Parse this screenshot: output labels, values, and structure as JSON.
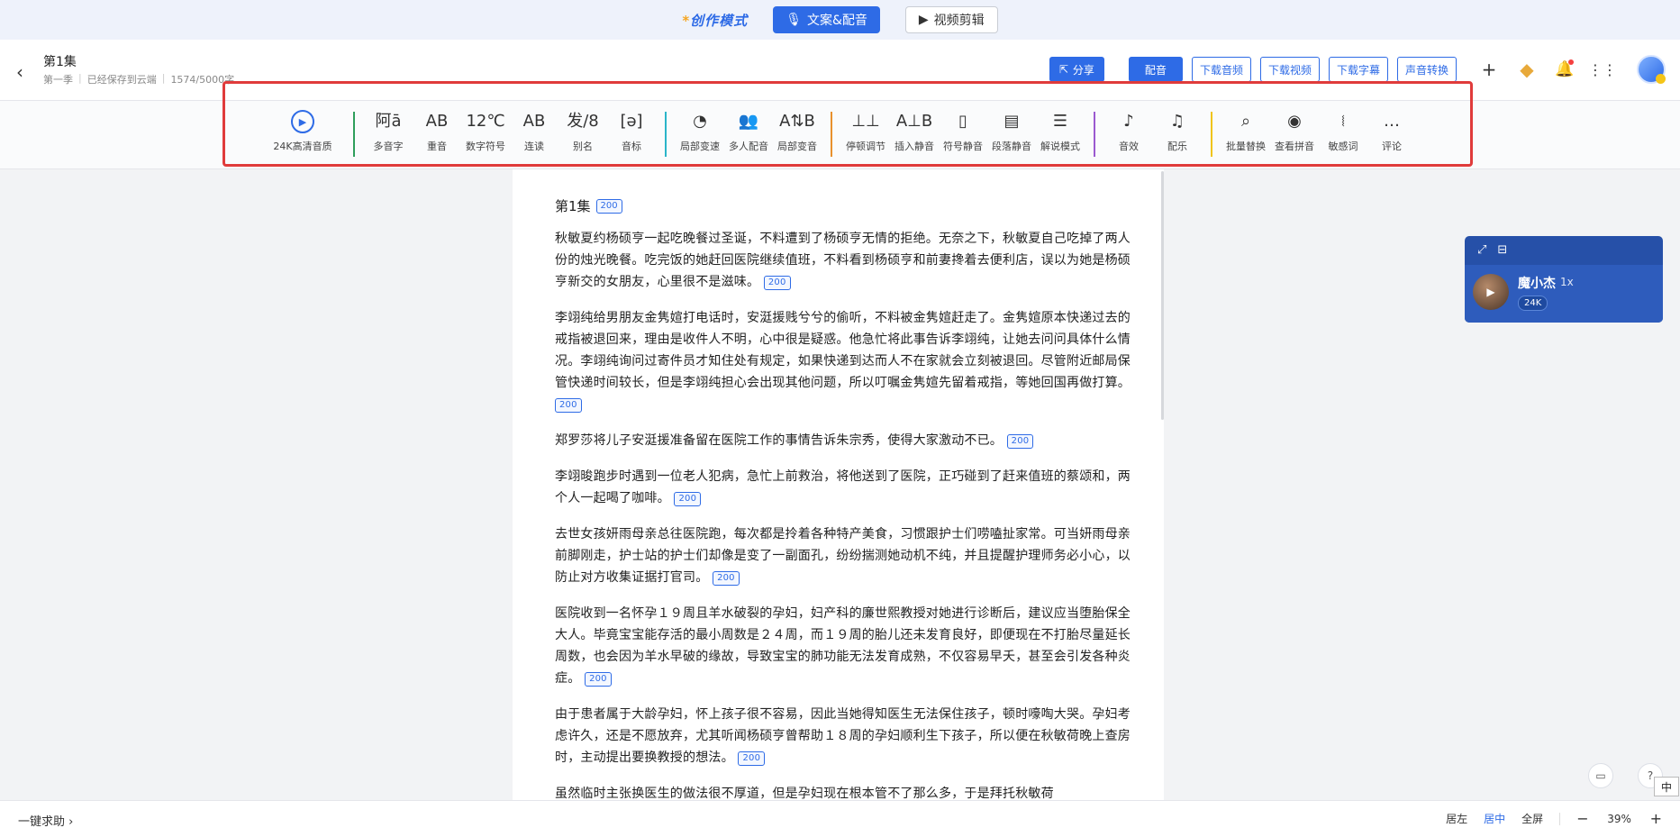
{
  "modebar": {
    "logo": "创作模式",
    "tabs": [
      {
        "label": "文案&配音",
        "icon": "microphone-icon",
        "active": true
      },
      {
        "label": "视频剪辑",
        "icon": "video-icon",
        "active": false
      }
    ]
  },
  "header": {
    "title": "第1集",
    "season": "第一季",
    "save_status": "已经保存到云端",
    "word_count": "1574/5000字",
    "share_label": "分享",
    "dub_label": "配音",
    "download_audio": "下载音频",
    "download_video": "下载视频",
    "download_subtitle": "下载字幕",
    "voice_convert": "声音转换"
  },
  "toolbar": {
    "groups": [
      {
        "color": "#2e9e5b",
        "items": [
          {
            "label": "24K高清音质",
            "icon": "play-circle-icon"
          }
        ]
      },
      {
        "color": "#2e9e5b",
        "items": [
          {
            "label": "多音字",
            "icon": "polyphone-icon",
            "glyph": "阿ā"
          },
          {
            "label": "重音",
            "icon": "stress-icon",
            "glyph": "AB"
          },
          {
            "label": "数字符号",
            "icon": "number-symbol-icon",
            "glyph": "12℃"
          },
          {
            "label": "连读",
            "icon": "liaison-icon",
            "glyph": "AB"
          },
          {
            "label": "别名",
            "icon": "alias-icon",
            "glyph": "发/8"
          },
          {
            "label": "音标",
            "icon": "phonetic-icon",
            "glyph": "[ə]"
          }
        ]
      },
      {
        "color": "#2bb5c9",
        "items": [
          {
            "label": "局部变速",
            "icon": "speed-gauge-icon",
            "glyph": "◔"
          },
          {
            "label": "多人配音",
            "icon": "multi-user-icon",
            "glyph": "👥"
          },
          {
            "label": "局部变音",
            "icon": "voice-change-icon",
            "glyph": "A⇅B"
          }
        ]
      },
      {
        "color": "#e8912d",
        "items": [
          {
            "label": "停顿调节",
            "icon": "pause-adjust-icon",
            "glyph": "⊥⊥"
          },
          {
            "label": "插入静音",
            "icon": "insert-silence-icon",
            "glyph": "A⊥B"
          },
          {
            "label": "符号静音",
            "icon": "symbol-silence-icon",
            "glyph": "▯"
          },
          {
            "label": "段落静音",
            "icon": "paragraph-silence-icon",
            "glyph": "▤"
          },
          {
            "label": "解说模式",
            "icon": "narration-icon",
            "glyph": "☰"
          }
        ]
      },
      {
        "color": "#9b59d0",
        "items": [
          {
            "label": "音效",
            "icon": "sound-effect-icon",
            "glyph": "♪"
          },
          {
            "label": "配乐",
            "icon": "music-icon",
            "glyph": "♫"
          }
        ]
      },
      {
        "color": "#f0c419",
        "items": [
          {
            "label": "批量替换",
            "icon": "search-icon",
            "glyph": "⌕"
          },
          {
            "label": "查看拼音",
            "icon": "eye-icon",
            "glyph": "◉"
          },
          {
            "label": "敏感词",
            "icon": "sensitive-word-icon",
            "glyph": "⧙"
          },
          {
            "label": "评论",
            "icon": "comment-icon",
            "glyph": "…"
          }
        ]
      }
    ]
  },
  "document": {
    "title": "第1集",
    "title_badge": "200",
    "paragraphs": [
      {
        "text": "秋敏夏约杨硕亨一起吃晚餐过圣诞，不料遭到了杨硕亨无情的拒绝。无奈之下，秋敏夏自己吃掉了两人份的烛光晚餐。吃完饭的她赶回医院继续值班，不料看到杨硕亨和前妻搀着去便利店，误以为她是杨硕亨新交的女朋友，心里很不是滋味。",
        "badge": "200"
      },
      {
        "text": "李翊纯给男朋友金隽媗打电话时，安涏援贱兮兮的偷听，不料被金隽媗赶走了。金隽媗原本快递过去的戒指被退回来，理由是收件人不明，心中很是疑惑。他急忙将此事告诉李翊纯，让她去问问具体什么情况。李翊纯询问过寄件员才知住处有规定，如果快递到达而人不在家就会立刻被退回。尽管附近邮局保管快递时间较长，但是李翊纯担心会出现其他问题，所以叮嘱金隽媗先留着戒指，等她回国再做打算。",
        "badge": "200"
      },
      {
        "text": "郑罗莎将儿子安涏援准备留在医院工作的事情告诉朱宗秀，使得大家激动不已。",
        "badge": "200"
      },
      {
        "text": "李翊晙跑步时遇到一位老人犯病，急忙上前救治，将他送到了医院，正巧碰到了赶来值班的蔡颂和，两个人一起喝了咖啡。",
        "badge": "200"
      },
      {
        "text": "去世女孩妍雨母亲总往医院跑，每次都是拎着各种特产美食，习惯跟护士们唠嗑扯家常。可当妍雨母亲前脚刚走，护士站的护士们却像是变了一副面孔，纷纷揣测她动机不纯，并且提醒护理师务必小心，以防止对方收集证据打官司。",
        "badge": "200"
      },
      {
        "text": "医院收到一名怀孕１９周且羊水破裂的孕妇，妇产科的廉世熙教授对她进行诊断后，建议应当堕胎保全大人。毕竟宝宝能存活的最小周数是２４周，而１９周的胎儿还未发育良好，即便现在不打胎尽量延长周数，也会因为羊水早破的缘故，导致宝宝的肺功能无法发育成熟，不仅容易早夭，甚至会引发各种炎症。",
        "badge": "200"
      },
      {
        "text": "由于患者属于大龄孕妇，怀上孩子很不容易，因此当她得知医生无法保住孩子，顿时嚎啕大哭。孕妇考虑许久，还是不愿放弃，尤其听闻杨硕亨曾帮助１８周的孕妇顺利生下孩子，所以便在秋敏荷晚上查房时，主动提出要换教授的想法。",
        "badge": "200"
      },
      {
        "text": "虽然临时主张换医生的做法很不厚道，但是孕妇现在根本管不了那么多，于是拜托秋敏荷",
        "badge": ""
      }
    ]
  },
  "voice_panel": {
    "name": "魔小杰",
    "speed": "1x",
    "quality": "24K"
  },
  "statusbar": {
    "help": "一键求助",
    "align_left": "居左",
    "align_center": "居中",
    "fullscreen": "全屏",
    "zoom": "39%"
  },
  "ime_label": "中"
}
